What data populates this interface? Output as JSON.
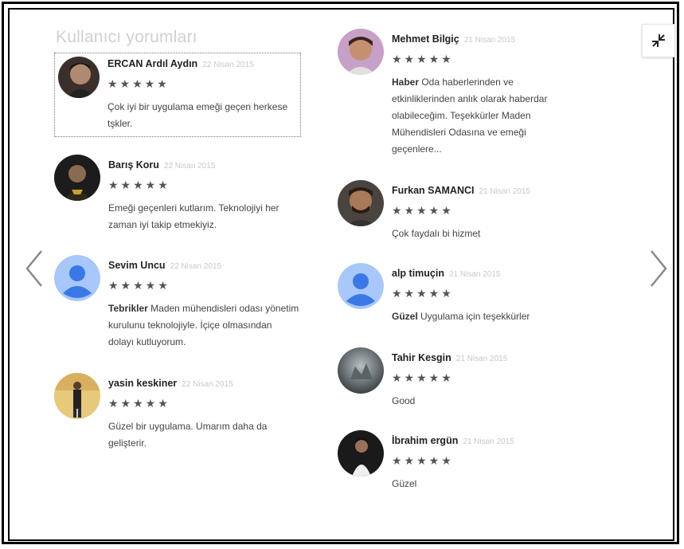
{
  "panel": {
    "title": "Kullanıcı yorumları"
  },
  "icons": {
    "collapse": "collapse-arrows-icon",
    "prev": "chevron-left-icon",
    "next": "chevron-right-icon",
    "star": "star-icon"
  },
  "stars_glyph": "★★★★★",
  "reviews": [
    {
      "author": "ERCAN Ardıl Aydın",
      "date": "22 Nisan 2015",
      "rating": 5,
      "lead": "",
      "text": "Çok iyi bir uygulama emeği geçen herkese tşkler.",
      "avatar": "photo"
    },
    {
      "author": "Barış Koru",
      "date": "22 Nisan 2015",
      "rating": 5,
      "lead": "",
      "text": "Emeği geçenleri kutlarım. Teknolojiyi her zaman iyi takip etmekiyiz.",
      "avatar": "photo"
    },
    {
      "author": "Sevim Uncu",
      "date": "22 Nisan 2015",
      "rating": 5,
      "lead": "Tebrikler",
      "text": " Maden mühendisleri odası yönetim kurulunu teknolojiyle. İçiçe olmasından dolayı kutluyorum.",
      "avatar": "default"
    },
    {
      "author": "yasin keskiner",
      "date": "22 Nisan 2015",
      "rating": 5,
      "lead": "",
      "text": "Güzel bir uygulama. Umarım daha da gelişterir.",
      "avatar": "photo"
    },
    {
      "author": "Mehmet Bilgiç",
      "date": "21 Nisan 2015",
      "rating": 5,
      "lead": "Haber",
      "text": " Oda haberlerinden ve etkinliklerinden anlık olarak haberdar olabileceğim. Teşekkürler Maden Mühendisleri Odasına ve emeği geçenlere...",
      "avatar": "photo"
    },
    {
      "author": "Furkan SAMANCI",
      "date": "21 Nisan 2015",
      "rating": 5,
      "lead": "",
      "text": "Çok faydalı bi hizmet",
      "avatar": "photo"
    },
    {
      "author": "alp timuçin",
      "date": "21 Nisan 2015",
      "rating": 5,
      "lead": "Güzel",
      "text": " Uygulama için teşekkürler",
      "avatar": "default"
    },
    {
      "author": "Tahir Kesgin",
      "date": "21 Nisan 2015",
      "rating": 5,
      "lead": "",
      "text": "Good",
      "avatar": "photo"
    },
    {
      "author": "İbrahim ergün",
      "date": "21 Nisan 2015",
      "rating": 5,
      "lead": "",
      "text": "Güzel",
      "avatar": "photo"
    }
  ],
  "colors": {
    "default_avatar_bg": "#a8c7fa",
    "default_avatar_fg": "#3b78e7"
  }
}
